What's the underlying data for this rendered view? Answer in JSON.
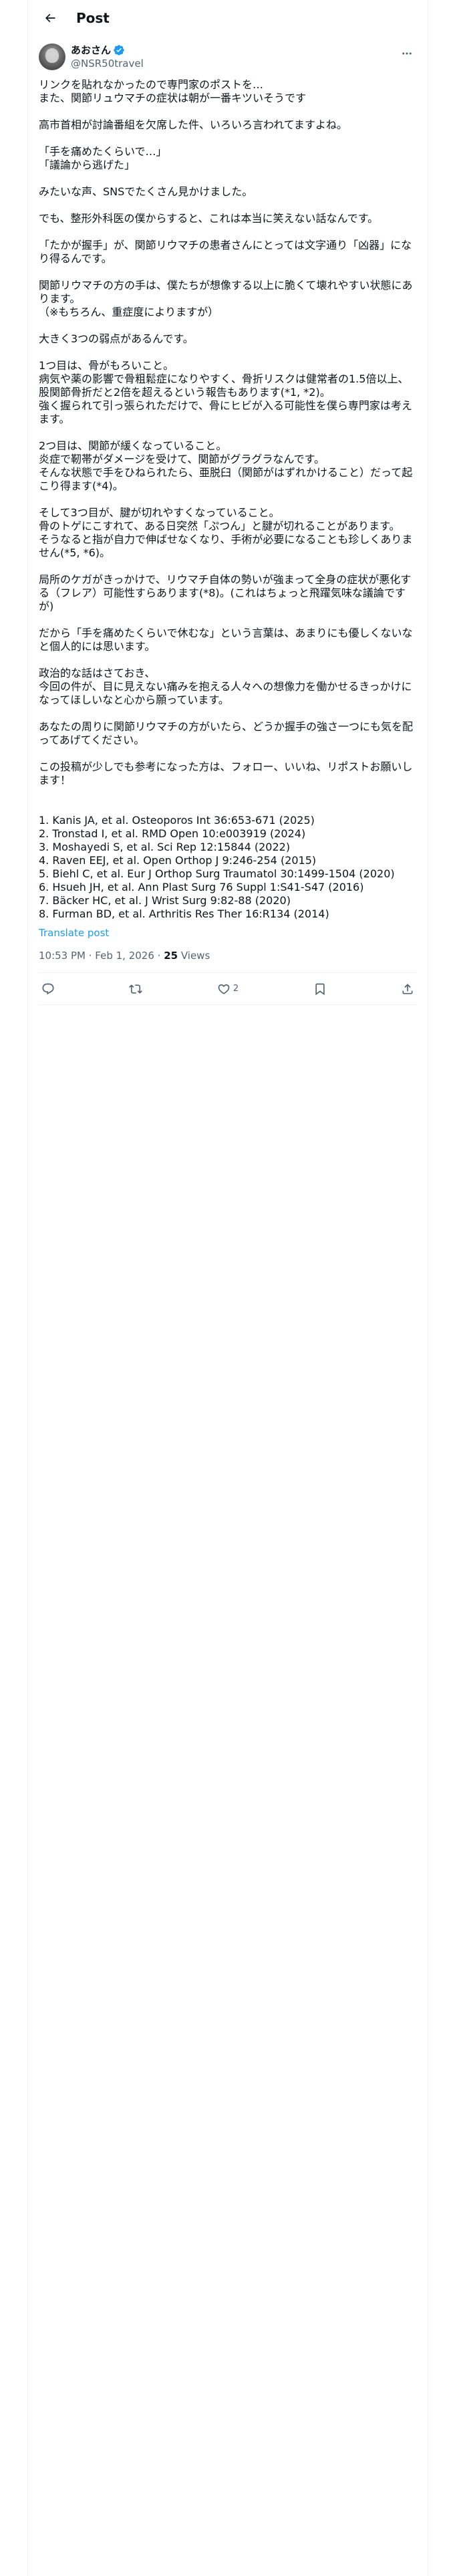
{
  "header": {
    "title": "Post"
  },
  "author": {
    "name": "あおさん",
    "handle": "@NSR50travel"
  },
  "body": "リンクを貼れなかったので専門家のポストを…\nまた、関節リュウマチの症状は朝が一番キツいそうです\n\n高市首相が討論番組を欠席した件、いろいろ言われてますよね。\n\n「手を痛めたくらいで…」\n「議論から逃げた」\n\nみたいな声、SNSでたくさん見かけました。\n\nでも、整形外科医の僕からすると、これは本当に笑えない話なんです。\n\n「たかが握手」が、関節リウマチの患者さんにとっては文字通り「凶器」になり得るんです。\n\n関節リウマチの方の手は、僕たちが想像する以上に脆くて壊れやすい状態にあります。\n（※もちろん、重症度によりますが）\n\n大きく3つの弱点があるんです。\n\n1つ目は、骨がもろいこと。\n病気や薬の影響で骨粗鬆症になりやすく、骨折リスクは健常者の1.5倍以上、股関節骨折だと2倍を超えるという報告もあります(*1, *2)。\n強く握られて引っ張られただけで、骨にヒビが入る可能性を僕ら専門家は考えます。\n\n2つ目は、関節が緩くなっていること。\n炎症で靭帯がダメージを受けて、関節がグラグラなんです。\nそんな状態で手をひねられたら、亜脱臼（関節がはずれかけること）だって起こり得ます(*4)。\n\nそして3つ目が、腱が切れやすくなっていること。\n骨のトゲにこすれて、ある日突然「ぷつん」と腱が切れることがあります。\nそうなると指が自力で伸ばせなくなり、手術が必要になることも珍しくありません(*5, *6)。\n\n局所のケガがきっかけで、リウマチ自体の勢いが強まって全身の症状が悪化する（フレア）可能性すらあります(*8)。(これはちょっと飛躍気味な議論ですが)\n\nだから「手を痛めたくらいで休むな」という言葉は、あまりにも優しくないなと個人的には思います。\n\n政治的な話はさておき、\n今回の件が、目に見えない痛みを抱える人々への想像力を働かせるきっかけになってほしいなと心から願っています。\n\nあなたの周りに関節リウマチの方がいたら、どうか握手の強さ一つにも気を配ってあげてください。\n\nこの投稿が少しでも参考になった方は、フォロー、いいね、リポストお願いします！\n\n\n1. Kanis JA, et al. Osteoporos Int 36:653-671 (2025)\n2. Tronstad I, et al. RMD Open 10:e003919 (2024)\n3. Moshayedi S, et al. Sci Rep 12:15844 (2022)\n4. Raven EEJ, et al. Open Orthop J 9:246-254 (2015)\n5. Biehl C, et al. Eur J Orthop Surg Traumatol 30:1499-1504 (2020)\n6. Hsueh JH, et al. Ann Plast Surg 76 Suppl 1:S41-S47 (2016)\n7. Bäcker HC, et al. J Wrist Surg 9:82-88 (2020)\n8. Furman BD, et al. Arthritis Res Ther 16:R134 (2014)",
  "translate_label": "Translate post",
  "meta": {
    "time": "10:53 PM",
    "sep": " · ",
    "date": "Feb 1, 2026",
    "views_count": "25",
    "views_label": "Views"
  },
  "actions": {
    "like_count": "2"
  },
  "colors": {
    "accent": "#1d9bf0",
    "secondary": "#536471",
    "text": "#0f1419",
    "border": "#eff3f4"
  },
  "icons": [
    "back-arrow-icon",
    "verified-badge-icon",
    "more-icon",
    "reply-icon",
    "repost-icon",
    "like-icon",
    "bookmark-icon",
    "share-icon"
  ]
}
